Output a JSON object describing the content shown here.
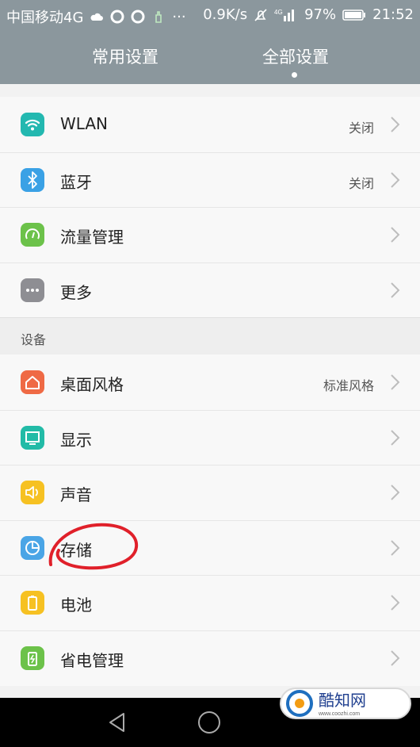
{
  "status": {
    "carrier": "中国移动4G",
    "speed": "0.9K/s",
    "battery": "97%",
    "time": "21:52",
    "icons": [
      "cloud-icon",
      "qq-icon",
      "qq-icon",
      "hand-icon",
      "more-dots-icon",
      "mute-icon",
      "signal-4g-icon",
      "battery-icon"
    ]
  },
  "tabs": [
    {
      "label": "常用设置"
    },
    {
      "label": "全部设置",
      "selected": true
    }
  ],
  "group1": [
    {
      "label": "WLAN",
      "value": "关闭",
      "icon": "wifi-icon",
      "color": "#23b8b0"
    },
    {
      "label": "蓝牙",
      "value": "关闭",
      "icon": "bluetooth-icon",
      "color": "#3aa1e5"
    },
    {
      "label": "流量管理",
      "value": "",
      "icon": "data-usage-icon",
      "color": "#6cc24a"
    },
    {
      "label": "更多",
      "value": "",
      "icon": "more-icon",
      "color": "#8e8e93"
    }
  ],
  "section": {
    "label": "设备"
  },
  "group2": [
    {
      "label": "桌面风格",
      "value": "标准风格",
      "icon": "home-style-icon",
      "color": "#ef6a45"
    },
    {
      "label": "显示",
      "value": "",
      "icon": "display-icon",
      "color": "#22bba7"
    },
    {
      "label": "声音",
      "value": "",
      "icon": "sound-icon",
      "color": "#f6c122"
    },
    {
      "label": "存储",
      "value": "",
      "icon": "storage-icon",
      "color": "#4aa5e6"
    },
    {
      "label": "电池",
      "value": "",
      "icon": "battery-icon",
      "color": "#f6c122"
    },
    {
      "label": "省电管理",
      "value": "",
      "icon": "power-saving-icon",
      "color": "#6cc24a"
    }
  ],
  "watermark": {
    "text": "酷知网",
    "url": "www.coozhi.com"
  }
}
